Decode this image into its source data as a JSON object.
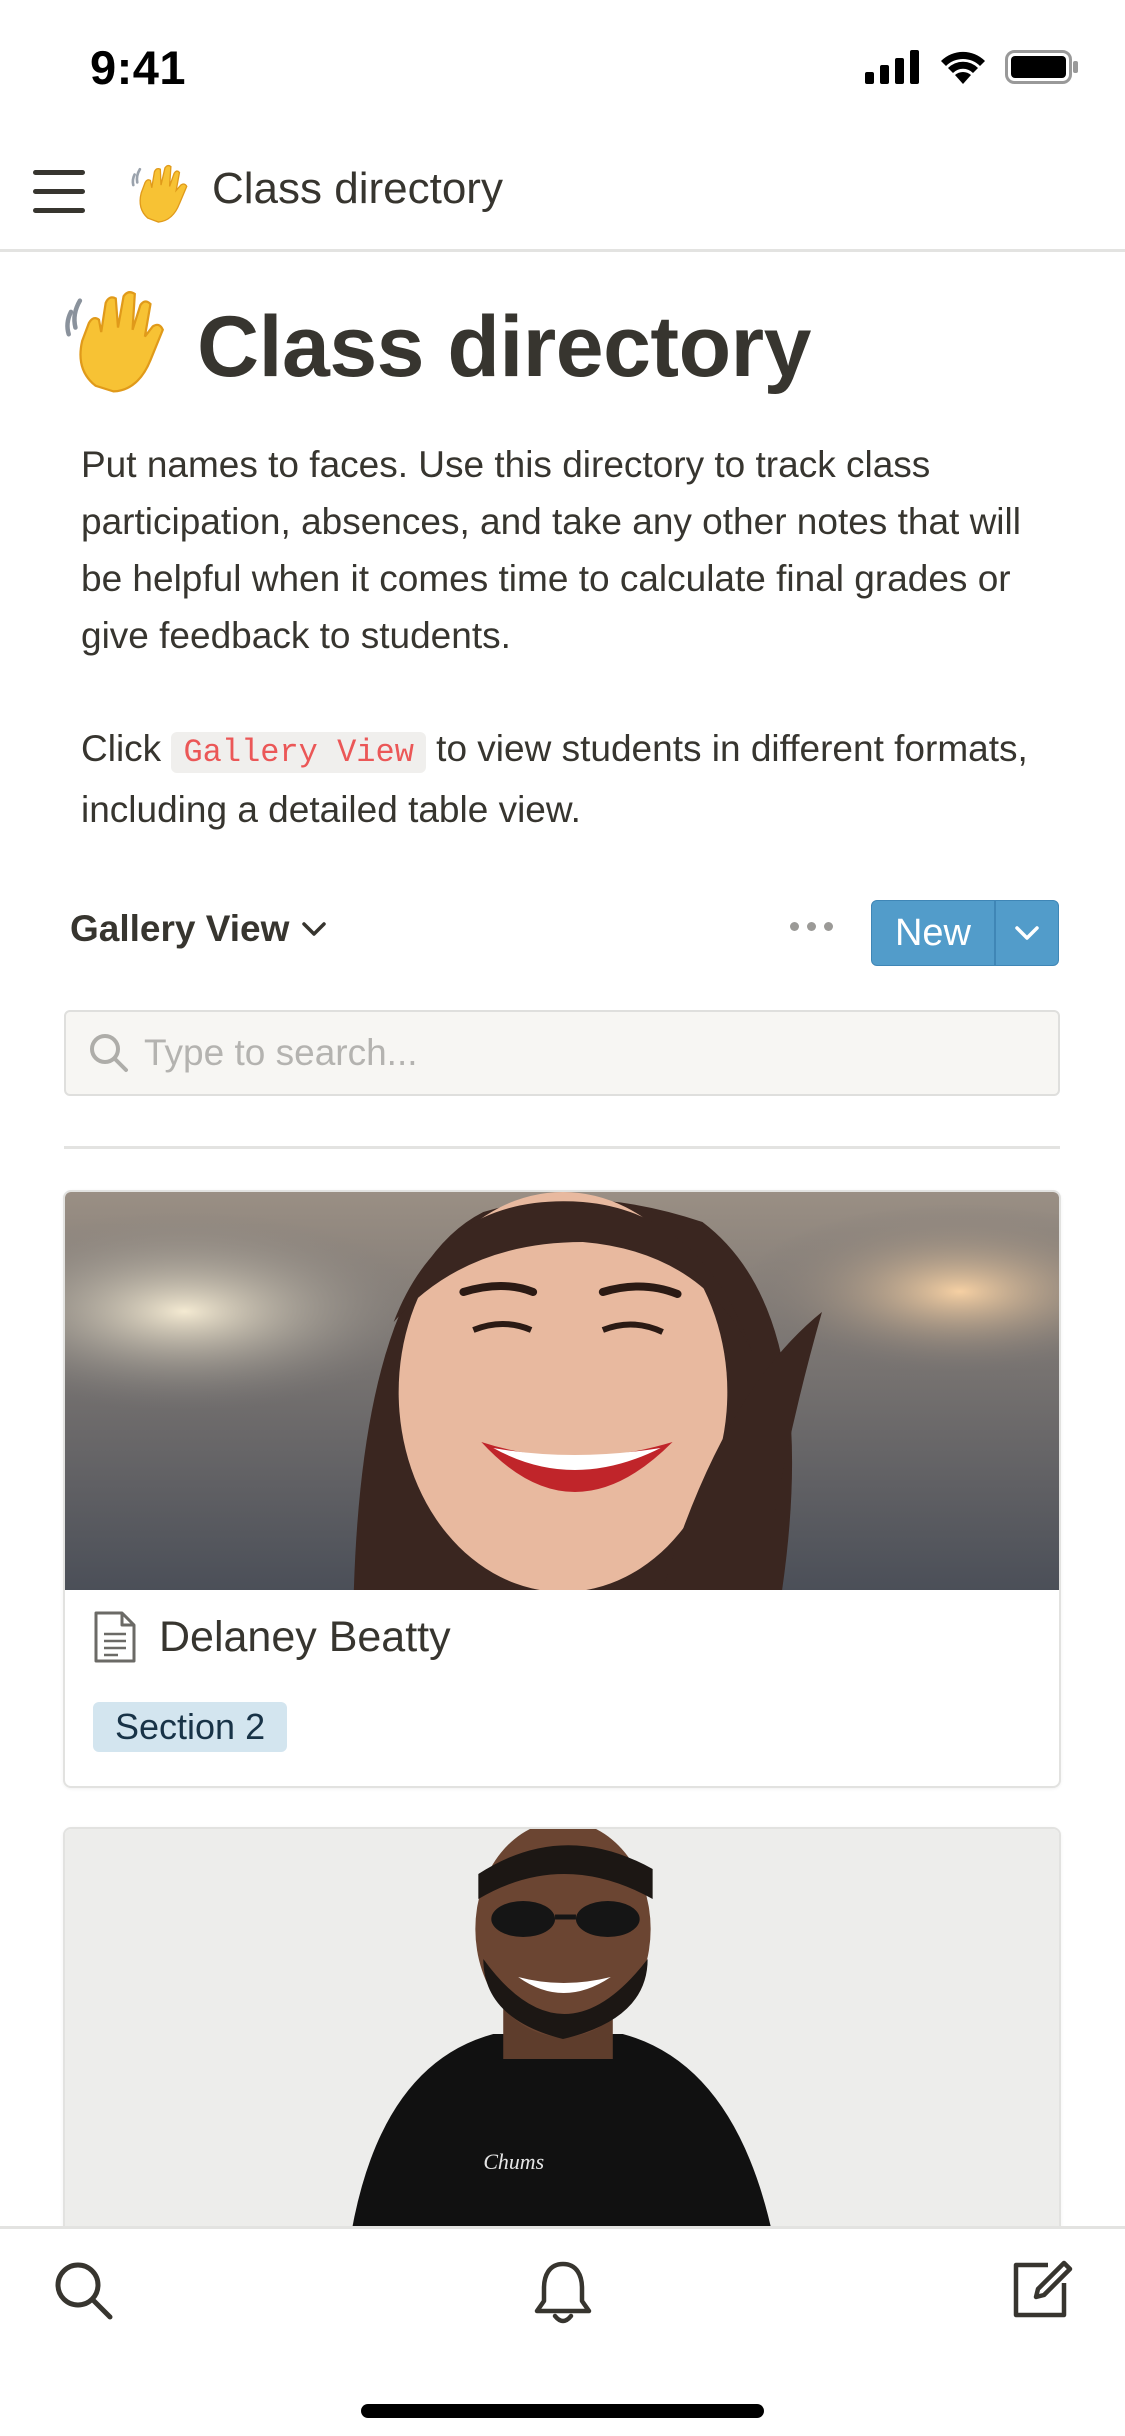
{
  "status_bar": {
    "time": "9:41",
    "icons": [
      "signal-icon",
      "wifi-icon",
      "battery-icon"
    ]
  },
  "nav": {
    "menu_icon": "hamburger-menu-icon",
    "page_emoji": "waving-hand-emoji",
    "title": "Class directory"
  },
  "page": {
    "emoji": "waving-hand-emoji",
    "title": "Class directory",
    "description": "Put names to faces. Use this directory to track class participation, absences, and take any other notes that will be helpful when it comes time to calculate final grades or give feedback to students.",
    "click_prefix": "Click ",
    "click_code": "Gallery View",
    "click_suffix": " to view students in different formats, including a detailed table view."
  },
  "toolbar": {
    "view_label": "Gallery View",
    "more_icon": "more-dots-icon",
    "new_label": "New",
    "new_chevron_icon": "chevron-down-icon"
  },
  "search": {
    "placeholder": "Type to search...",
    "value": ""
  },
  "cards": [
    {
      "name": "Delaney Beatty",
      "tag": "Section 2",
      "tag_color": "#d3e5ef",
      "cover": "photo-smiling-woman"
    },
    {
      "name": "",
      "cover": "photo-smiling-man-sunglasses"
    }
  ],
  "bottom_bar": {
    "icons": [
      "search-icon",
      "bell-icon",
      "compose-icon"
    ]
  },
  "colors": {
    "accent": "#529cca",
    "code_text": "#eb5757",
    "text": "#37352f"
  }
}
